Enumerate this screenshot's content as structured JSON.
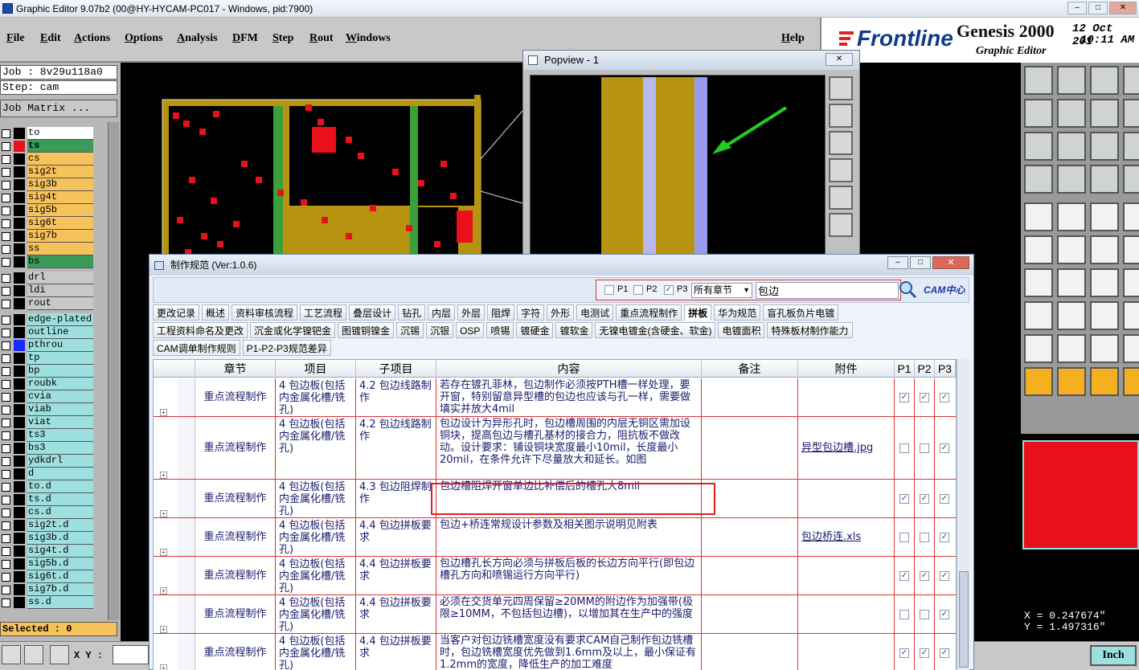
{
  "window": {
    "title": "Graphic Editor 9.07b2 (00@HY-HYCAM-PC017 - Windows, pid:7900)"
  },
  "menu": [
    "File",
    "Edit",
    "Actions",
    "Options",
    "Analysis",
    "DFM",
    "Step",
    "Rout",
    "Windows"
  ],
  "help_label": "Help",
  "brand": {
    "logo": "Frontline",
    "product": "Genesis 2000",
    "subtitle": "Graphic Editor",
    "date": "12 Oct 201",
    "time": "10:11 AM"
  },
  "job": {
    "job_label": "Job : 8v29u118a0",
    "step_label": "Step: cam",
    "matrix_button": "Job Matrix ..."
  },
  "layers": [
    {
      "name": "to",
      "color": "#ffffff",
      "swatch": "#000000"
    },
    {
      "name": "ts",
      "color": "#3a9a5a",
      "swatch": "#e8101a",
      "active": true
    },
    {
      "name": "cs",
      "color": "#f6c25c",
      "swatch": "#000000"
    },
    {
      "name": "sig2t",
      "color": "#f6c25c",
      "swatch": "#000000"
    },
    {
      "name": "sig3b",
      "color": "#f6c25c",
      "swatch": "#000000"
    },
    {
      "name": "sig4t",
      "color": "#f6c25c",
      "swatch": "#000000"
    },
    {
      "name": "sig5b",
      "color": "#f6c25c",
      "swatch": "#000000"
    },
    {
      "name": "sig6t",
      "color": "#f6c25c",
      "swatch": "#000000"
    },
    {
      "name": "sig7b",
      "color": "#f6c25c",
      "swatch": "#000000"
    },
    {
      "name": "ss",
      "color": "#f6c25c",
      "swatch": "#000000"
    },
    {
      "name": "bs",
      "color": "#3a9a5a",
      "swatch": "#000000"
    },
    {
      "name": "drl",
      "color": "#c8c8c8",
      "swatch": "#000000"
    },
    {
      "name": "ldi",
      "color": "#c8c8c8",
      "swatch": "#000000"
    },
    {
      "name": "rout",
      "color": "#c8c8c8",
      "swatch": "#000000"
    },
    {
      "name": "edge-plated",
      "color": "#9ee0e0",
      "swatch": "#000000"
    },
    {
      "name": "outline",
      "color": "#9ee0e0",
      "swatch": "#000000"
    },
    {
      "name": "pthrou",
      "color": "#9ee0e0",
      "swatch": "#1a2aff"
    },
    {
      "name": "tp",
      "color": "#9ee0e0",
      "swatch": "#000000"
    },
    {
      "name": "bp",
      "color": "#9ee0e0",
      "swatch": "#000000"
    },
    {
      "name": "roubk",
      "color": "#9ee0e0",
      "swatch": "#000000"
    },
    {
      "name": "cvia",
      "color": "#9ee0e0",
      "swatch": "#000000"
    },
    {
      "name": "viab",
      "color": "#9ee0e0",
      "swatch": "#000000"
    },
    {
      "name": "viat",
      "color": "#9ee0e0",
      "swatch": "#000000"
    },
    {
      "name": "ts3",
      "color": "#9ee0e0",
      "swatch": "#000000"
    },
    {
      "name": "bs3",
      "color": "#9ee0e0",
      "swatch": "#000000"
    },
    {
      "name": "ydkdrl",
      "color": "#9ee0e0",
      "swatch": "#000000"
    },
    {
      "name": "d",
      "color": "#9ee0e0",
      "swatch": "#000000"
    },
    {
      "name": "to.d",
      "color": "#9ee0e0",
      "swatch": "#000000"
    },
    {
      "name": "ts.d",
      "color": "#9ee0e0",
      "swatch": "#000000"
    },
    {
      "name": "cs.d",
      "color": "#9ee0e0",
      "swatch": "#000000"
    },
    {
      "name": "sig2t.d",
      "color": "#9ee0e0",
      "swatch": "#000000"
    },
    {
      "name": "sig3b.d",
      "color": "#9ee0e0",
      "swatch": "#000000"
    },
    {
      "name": "sig4t.d",
      "color": "#9ee0e0",
      "swatch": "#000000"
    },
    {
      "name": "sig5b.d",
      "color": "#9ee0e0",
      "swatch": "#000000"
    },
    {
      "name": "sig6t.d",
      "color": "#9ee0e0",
      "swatch": "#000000"
    },
    {
      "name": "sig7b.d",
      "color": "#9ee0e0",
      "swatch": "#000000"
    },
    {
      "name": "ss.d",
      "color": "#9ee0e0",
      "swatch": "#000000"
    }
  ],
  "selected_label": "Selected : 0",
  "xy_label": "X Y :",
  "units_button": "Inch",
  "coords": {
    "x": "X = 0.247674\"",
    "y": "Y = 1.497316\""
  },
  "popview": {
    "title": "Popview - 1"
  },
  "spec": {
    "title": "制作规范 (Ver:1.0.6)",
    "filters": {
      "p1": "P1",
      "p2": "P2",
      "p3": "P3",
      "chapter_select": "所有章节",
      "search_value": "包边"
    },
    "cam_logo": "CAM中心",
    "tabs_row1": [
      "更改记录",
      "概述",
      "资料审核流程",
      "工艺流程",
      "叠层设计",
      "钻孔",
      "内层",
      "外层",
      "阻焊",
      "字符",
      "外形",
      "电测试",
      "重点流程制作",
      "拼板",
      "华为规范",
      "盲孔板负片电镀"
    ],
    "tabs_row2": [
      "工程资料命名及更改",
      "沉金或化学镍钯金",
      "图镀铜镍金",
      "沉锡",
      "沉银",
      "OSP",
      "喷锡",
      "镀硬金",
      "镀软金",
      "无镍电镀金(含硬金、软金)",
      "电镀面积",
      "特殊板材制作能力"
    ],
    "tabs_row3": [
      "CAM调单制作规则",
      "P1-P2-P3规范差异"
    ],
    "active_tab": "拼板",
    "columns": [
      "章节",
      "项目",
      "子项目",
      "内容",
      "备注",
      "附件",
      "P1",
      "P2",
      "P3"
    ],
    "rows": [
      {
        "chapter": "重点流程制作",
        "item": "4 包边板(包括内金属化槽/铣孔)",
        "sub": "4.2 包边线路制作",
        "content": "若存在镀孔菲林，包边制作必须按PTH槽一样处理，要开窗，特别留意异型槽的包边也应该与孔一样，需要做填实并放大4mil",
        "note": "",
        "attach": "",
        "p1": true,
        "p2": true,
        "p3": true
      },
      {
        "chapter": "重点流程制作",
        "item": "4 包边板(包括内金属化槽/铣孔)",
        "sub": "4.2 包边线路制作",
        "content": "包边设计为异形孔时，包边槽周围的内层无铜区需加设铜块，提高包边与槽孔基材的接合力，阻抗板不做改动。设计要求：铺设铜块宽度最小10mil，长度最小20mil，在条件允许下尽量放大和延长。如图",
        "note": "",
        "attach": "异型包边槽.jpg",
        "p1": false,
        "p2": false,
        "p3": true
      },
      {
        "chapter": "重点流程制作",
        "item": "4 包边板(包括内金属化槽/铣孔)",
        "sub": "4.3 包边阻焊制作",
        "content": "包边槽阻焊开窗单边比补偿后的槽孔大8mil",
        "note": "",
        "attach": "",
        "p1": true,
        "p2": true,
        "p3": true
      },
      {
        "chapter": "重点流程制作",
        "item": "4 包边板(包括内金属化槽/铣孔)",
        "sub": "4.4 包边拼板要求",
        "content": "包边+桥连常规设计参数及相关图示说明见附表",
        "note": "",
        "attach": "包边桥连.xls",
        "p1": false,
        "p2": false,
        "p3": true
      },
      {
        "chapter": "重点流程制作",
        "item": "4 包边板(包括内金属化槽/铣孔)",
        "sub": "4.4 包边拼板要求",
        "content": "包边槽孔长方向必须与拼板后板的长边方向平行(即包边槽孔方向和喷锡运行方向平行)",
        "note": "",
        "attach": "",
        "p1": true,
        "p2": true,
        "p3": true
      },
      {
        "chapter": "重点流程制作",
        "item": "4 包边板(包括内金属化槽/铣孔)",
        "sub": "4.4 包边拼板要求",
        "content": "必须在交货单元四周保留≥20MM的附边作为加强带(极限≥10MM，不包括包边槽)，以增加其在生产中的强度",
        "note": "",
        "attach": "",
        "p1": false,
        "p2": false,
        "p3": true
      },
      {
        "chapter": "重点流程制作",
        "item": "4 包边板(包括内金属化槽/铣孔)",
        "sub": "4.4 包边拼板要求",
        "content": "当客户对包边铣槽宽度没有要求CAM自己制作包边铣槽时，包边铣槽宽度优先做到1.6mm及以上，最小保证有1.2mm的宽度，降低生产的加工难度",
        "note": "",
        "attach": "",
        "p1": true,
        "p2": true,
        "p3": true
      }
    ]
  }
}
